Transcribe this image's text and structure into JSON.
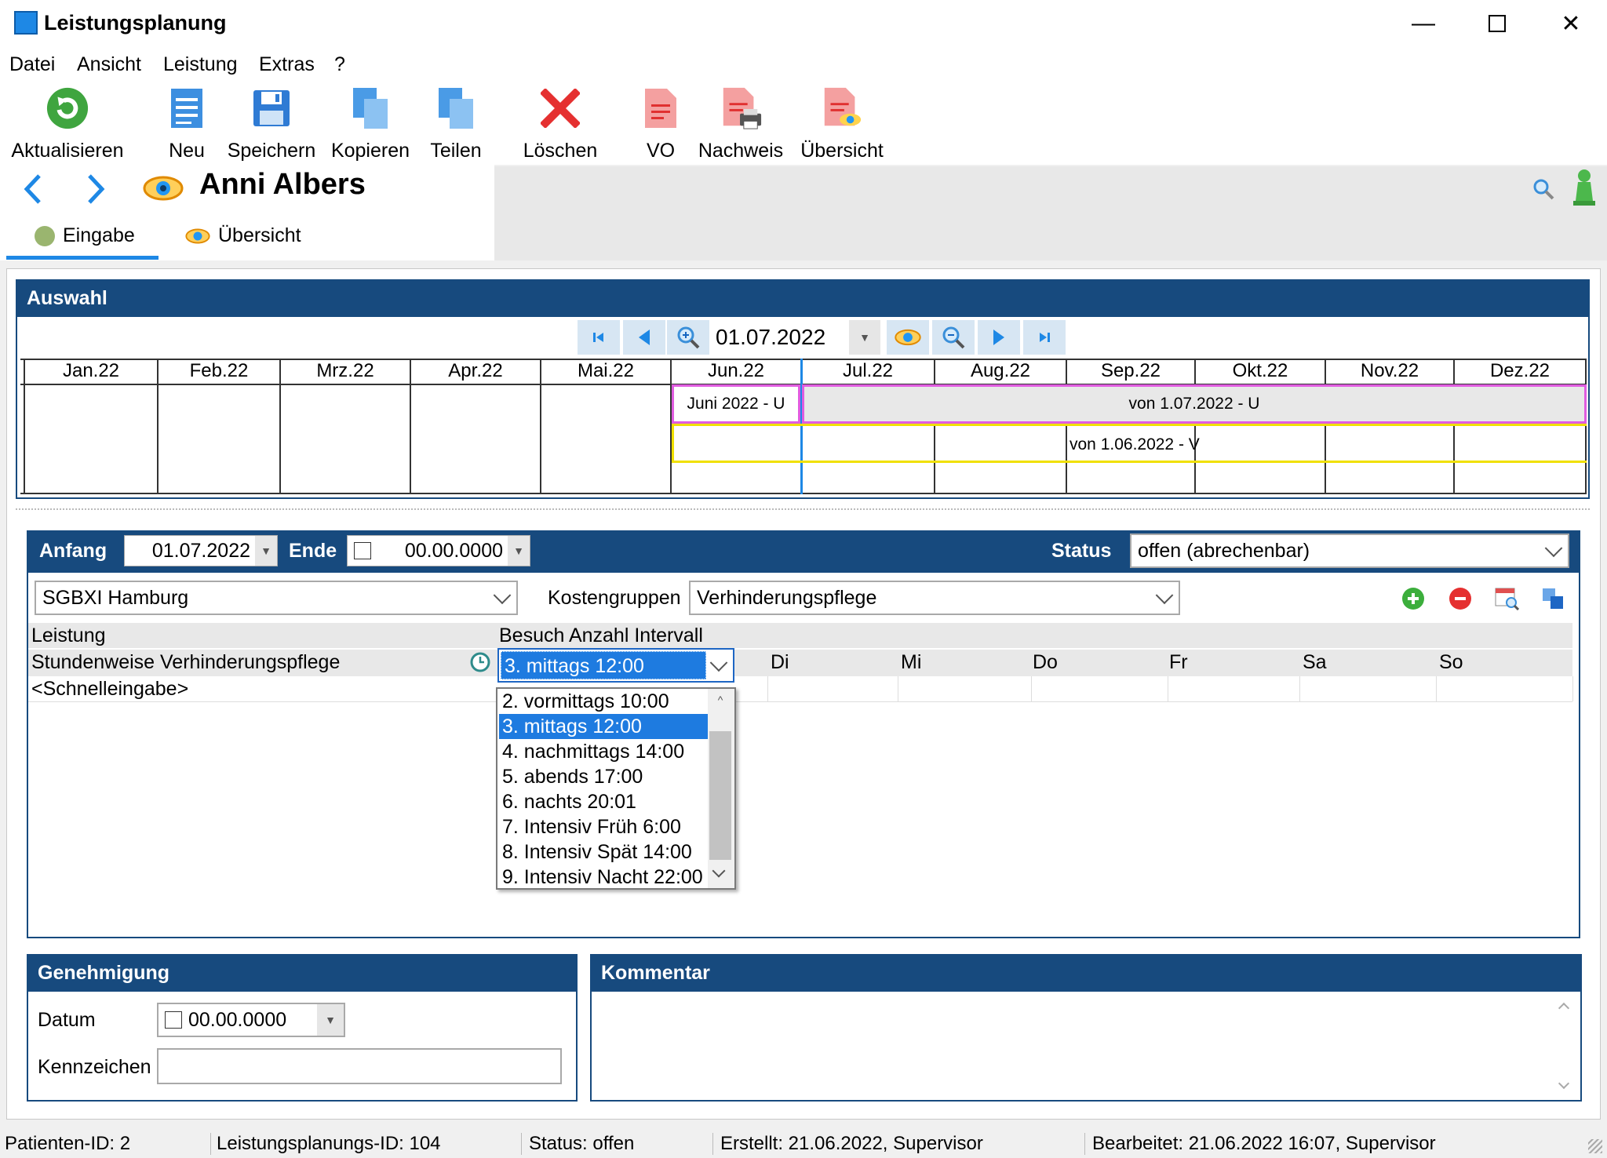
{
  "window": {
    "title": "Leistungsplanung"
  },
  "menu": [
    "Datei",
    "Ansicht",
    "Leistung",
    "Extras",
    "?"
  ],
  "toolbar": {
    "refresh": "Aktualisieren",
    "new": "Neu",
    "save": "Speichern",
    "copy": "Kopieren",
    "split": "Teilen",
    "delete": "Löschen",
    "vo": "VO",
    "nachweis": "Nachweis",
    "overview": "Übersicht"
  },
  "patient": {
    "name": "Anni Albers"
  },
  "tabs": {
    "input": "Eingabe",
    "overview": "Übersicht"
  },
  "auswahl": {
    "title": "Auswahl",
    "date": "01.07.2022",
    "months": [
      "Jan.22",
      "Feb.22",
      "Mrz.22",
      "Apr.22",
      "Mai.22",
      "Jun.22",
      "Jul.22",
      "Aug.22",
      "Sep.22",
      "Okt.22",
      "Nov.22",
      "Dez.22"
    ],
    "bars": {
      "june_u": "Juni 2022 - U",
      "from_july_u": "von 1.07.2022 - U",
      "from_june_v": "von 1.06.2022 - V"
    }
  },
  "detail": {
    "anfang_label": "Anfang",
    "anfang_value": "01.07.2022",
    "ende_label": "Ende",
    "ende_value": "00.00.0000",
    "status_label": "Status",
    "status_value": "offen (abrechenbar)",
    "kasse_value": "SGBXI Hamburg",
    "kostengruppen_label": "Kostengruppen",
    "kostengruppen_value": "Verhinderungspflege",
    "col_leistung": "Leistung",
    "col_besuch": "Besuch Anzahl Intervall",
    "days": [
      "Di",
      "Mi",
      "Do",
      "Fr",
      "Sa",
      "So"
    ],
    "row_leistung": "Stundenweise Verhinderungspflege",
    "row_besuch": "3. mittags 12:00",
    "quick_entry": "<Schnelleingabe>"
  },
  "dropdown": {
    "options": [
      "2. vormittags 10:00",
      "3. mittags 12:00",
      "4. nachmittags 14:00",
      "5. abends 17:00",
      "6. nachts 20:01",
      "7. Intensiv Früh 6:00",
      "8. Intensiv Spät 14:00",
      "9. Intensiv Nacht 22:00"
    ],
    "selected_index": 1
  },
  "genehmigung": {
    "title": "Genehmigung",
    "datum_label": "Datum",
    "datum_value": "00.00.0000",
    "kennzeichen_label": "Kennzeichen",
    "kennzeichen_value": ""
  },
  "kommentar": {
    "title": "Kommentar",
    "text": ""
  },
  "statusbar": {
    "patient_id": "Patienten-ID: 2",
    "plan_id": "Leistungsplanungs-ID: 104",
    "status": "Status: offen",
    "created": "Erstellt: 21.06.2022, Supervisor",
    "edited": "Bearbeitet: 21.06.2022 16:07, Supervisor"
  },
  "colors": {
    "panel_header": "#174a7e",
    "selection": "#1e7be0",
    "bar_u_border": "#e05ce0",
    "bar_v_border": "#f0e000"
  }
}
